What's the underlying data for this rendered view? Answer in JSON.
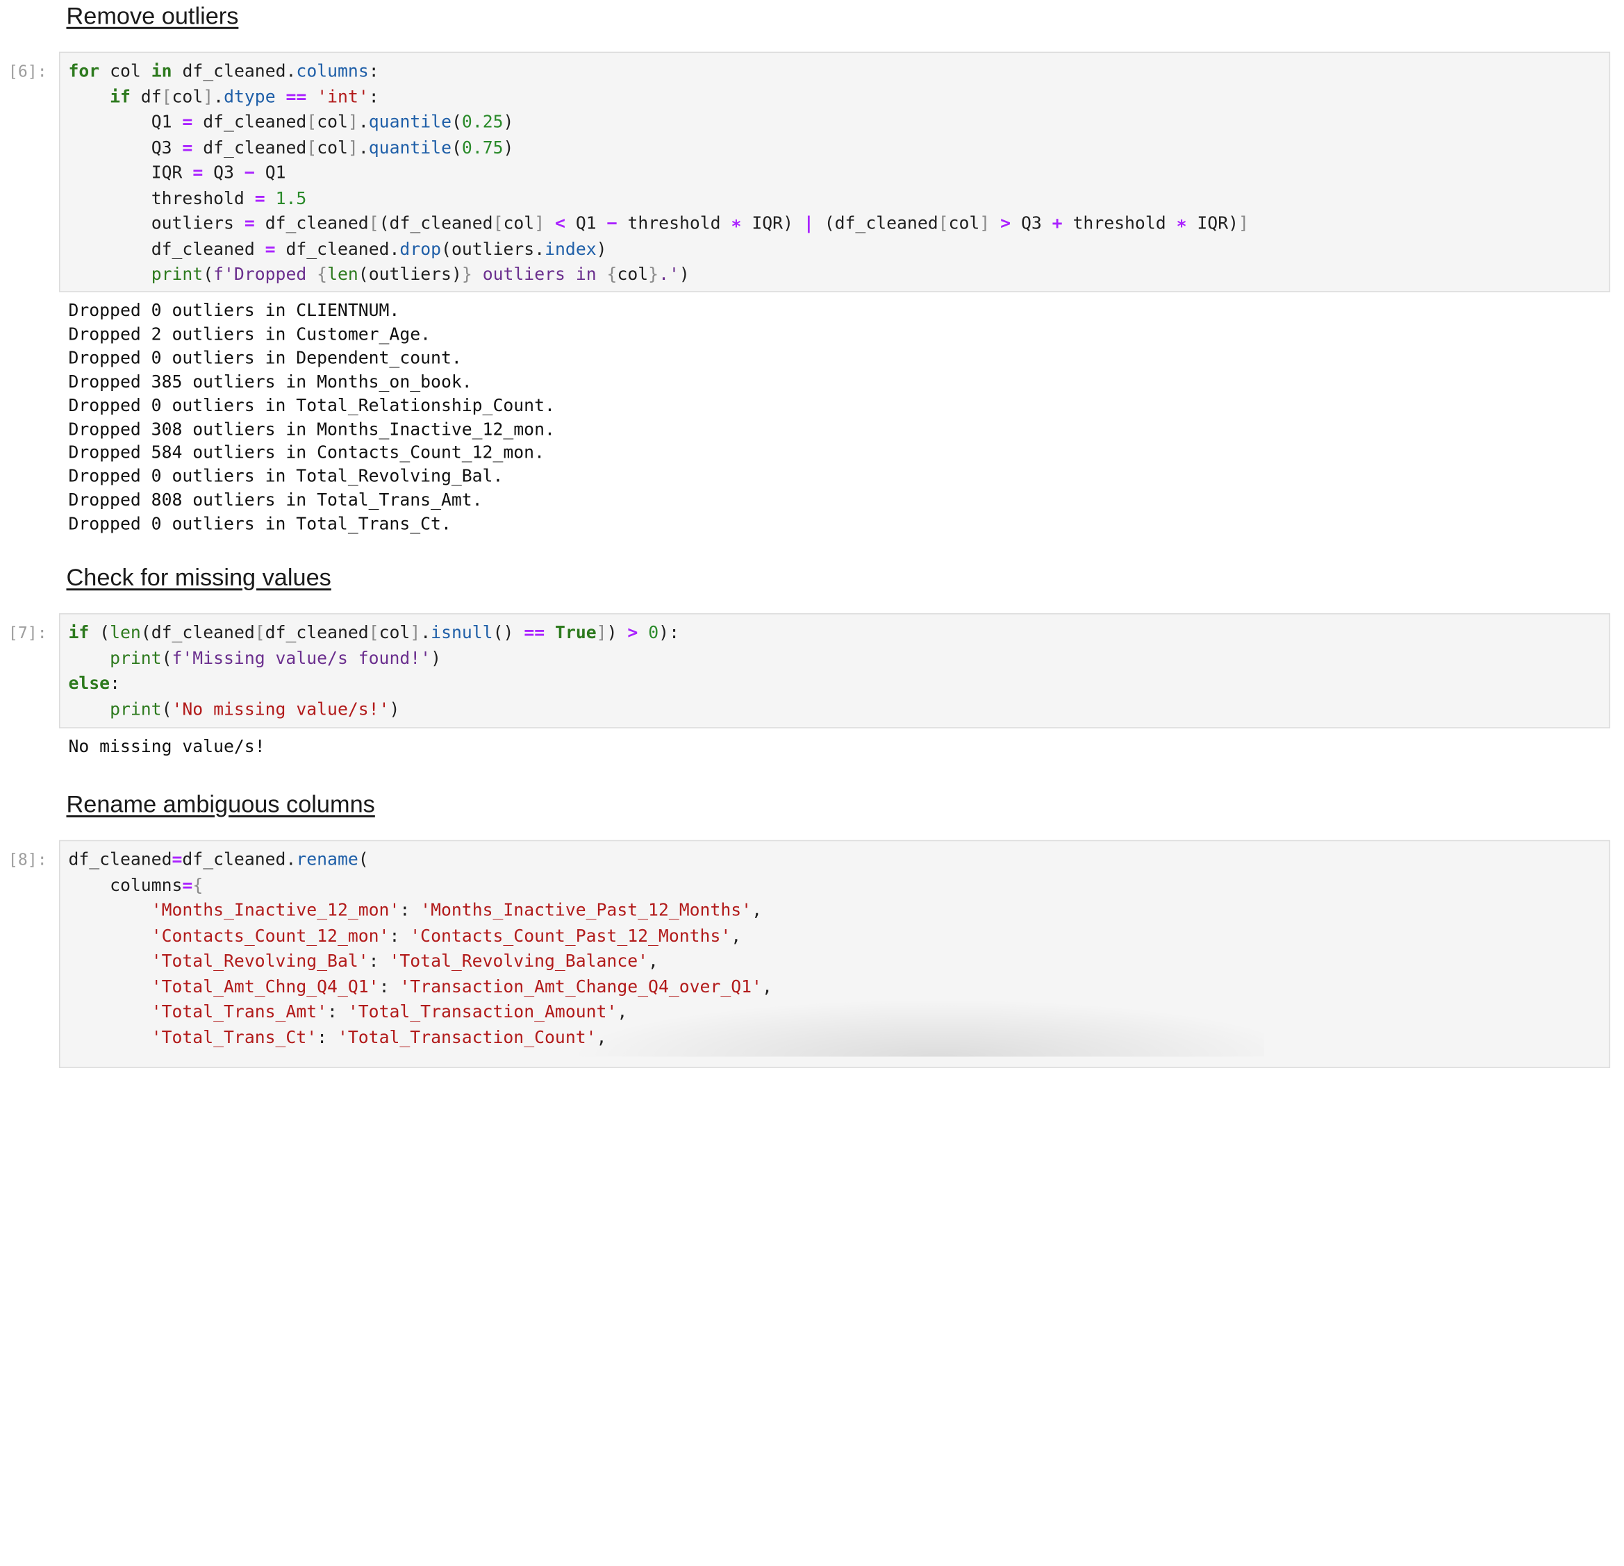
{
  "sections": {
    "s1": "Remove outliers",
    "s2": "Check for missing values",
    "s3": "Rename ambiguous columns"
  },
  "cells": {
    "c6": {
      "prompt": "[6]:"
    },
    "c7": {
      "prompt": "[7]:"
    },
    "c8": {
      "prompt": "[8]:"
    }
  },
  "outputs": {
    "o6": [
      "Dropped 0 outliers in CLIENTNUM.",
      "Dropped 2 outliers in Customer_Age.",
      "Dropped 0 outliers in Dependent_count.",
      "Dropped 385 outliers in Months_on_book.",
      "Dropped 0 outliers in Total_Relationship_Count.",
      "Dropped 308 outliers in Months_Inactive_12_mon.",
      "Dropped 584 outliers in Contacts_Count_12_mon.",
      "Dropped 0 outliers in Total_Revolving_Bal.",
      "Dropped 808 outliers in Total_Trans_Amt.",
      "Dropped 0 outliers in Total_Trans_Ct."
    ],
    "o7": "No missing value/s!"
  },
  "code": {
    "c6": {
      "l1": [
        "for",
        "col",
        "in",
        "df_cleaned",
        "columns"
      ],
      "l2": [
        "if",
        "df",
        "col",
        "dtype",
        "==",
        "'int'"
      ],
      "l3": [
        "Q1",
        "=",
        "df_cleaned",
        "col",
        "quantile",
        "0.25"
      ],
      "l4": [
        "Q3",
        "=",
        "df_cleaned",
        "col",
        "quantile",
        "0.75"
      ],
      "l5": [
        "IQR",
        "=",
        "Q3",
        "−",
        "Q1"
      ],
      "l6": [
        "threshold",
        "=",
        "1.5"
      ],
      "l7": [
        "outliers",
        "=",
        "df_cleaned",
        "df_cleaned",
        "col",
        "<",
        "Q1",
        "−",
        "threshold",
        "∗",
        "IQR",
        "|",
        "df_cleaned",
        "col",
        ">",
        "Q3",
        "+",
        "threshold",
        "∗",
        "IQR"
      ],
      "l8": [
        "df_cleaned",
        "=",
        "df_cleaned",
        "drop",
        "outliers",
        "index"
      ],
      "l9": [
        "print",
        "f'Dropped ",
        "{",
        "len",
        "outliers",
        "}",
        " outliers in ",
        "{",
        "col",
        "}",
        ".'"
      ]
    },
    "c7": {
      "l1": [
        "if",
        "len",
        "df_cleaned",
        "df_cleaned",
        "col",
        "isnull",
        "==",
        "True",
        ">",
        "0"
      ],
      "l2": [
        "print",
        "f'Missing value/s found!'"
      ],
      "l3": [
        "else"
      ],
      "l4": [
        "print",
        "'No missing value/s!'"
      ]
    },
    "c8": {
      "l1": [
        "df_cleaned",
        "=",
        "df_cleaned",
        "rename"
      ],
      "l2": [
        "columns",
        "="
      ],
      "map": [
        [
          "'Months_Inactive_12_mon'",
          "'Months_Inactive_Past_12_Months'"
        ],
        [
          "'Contacts_Count_12_mon'",
          "'Contacts_Count_Past_12_Months'"
        ],
        [
          "'Total_Revolving_Bal'",
          "'Total_Revolving_Balance'"
        ],
        [
          "'Total_Amt_Chng_Q4_Q1'",
          "'Transaction_Amt_Change_Q4_over_Q1'"
        ],
        [
          "'Total_Trans_Amt'",
          "'Total_Transaction_Amount'"
        ],
        [
          "'Total_Trans_Ct'",
          "'Total_Transaction_Count'"
        ]
      ]
    }
  },
  "colors": {
    "keyword": "#2d7a1e",
    "operator": "#aa22ff",
    "string": "#b21b1b",
    "attribute": "#1f5fa8",
    "prompt": "#9e9e9e",
    "cell_bg": "#f5f5f5"
  }
}
